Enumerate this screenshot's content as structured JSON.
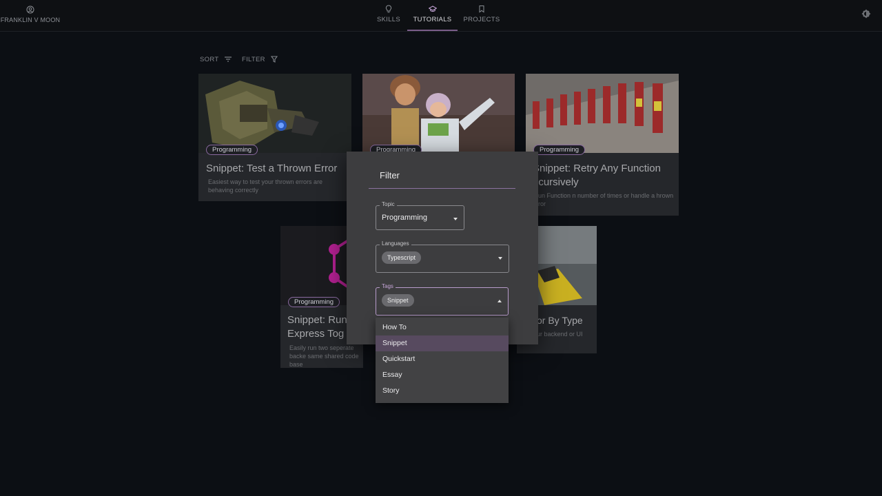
{
  "header": {
    "brand": "FRANKLIN V MOON",
    "nav": [
      {
        "label": "SKILLS",
        "icon": "lightbulb-icon"
      },
      {
        "label": "TUTORIALS",
        "icon": "graduation-cap-icon",
        "active": true
      },
      {
        "label": "PROJECTS",
        "icon": "bookmark-icon"
      }
    ],
    "theme_icon": "brightness-icon"
  },
  "toolbar": {
    "sort_label": "SORT",
    "filter_label": "FILTER"
  },
  "cards": [
    {
      "chip": "Programming",
      "title": "Snippet: Test a Thrown Error",
      "desc": "Easiest way to test your thrown errors are behaving correctly"
    },
    {
      "chip": "Programming",
      "title": "",
      "desc": ""
    },
    {
      "chip": "Programming",
      "title": "Snippet: Retry Any Function Recursively",
      "title_visible": "Snippet: Retry Any Function ecursively",
      "desc": "Rerun Function n number of times or handle a thrown error",
      "desc_visible": "erun Function n number of times or handle a hrown error"
    },
    {
      "chip": "Programming",
      "title": "Snippet: Run Express Tog",
      "desc": "Easily run two seperate backe same shared code base"
    },
    {
      "title": "or By Type",
      "desc": "ur backend or UI"
    }
  ],
  "filter_dialog": {
    "title": "Filter",
    "topic": {
      "label": "Topic",
      "value": "Programming"
    },
    "languages": {
      "label": "Languages",
      "chip": "Typescript"
    },
    "tags": {
      "label": "Tags",
      "chip": "Snippet"
    },
    "tag_options": [
      "How To",
      "Snippet",
      "Quickstart",
      "Essay",
      "Story"
    ],
    "selected_option": "Snippet"
  },
  "colors": {
    "accent": "#8a6aa0",
    "background": "#0c0f14",
    "dialog": "#3d3d3f"
  }
}
